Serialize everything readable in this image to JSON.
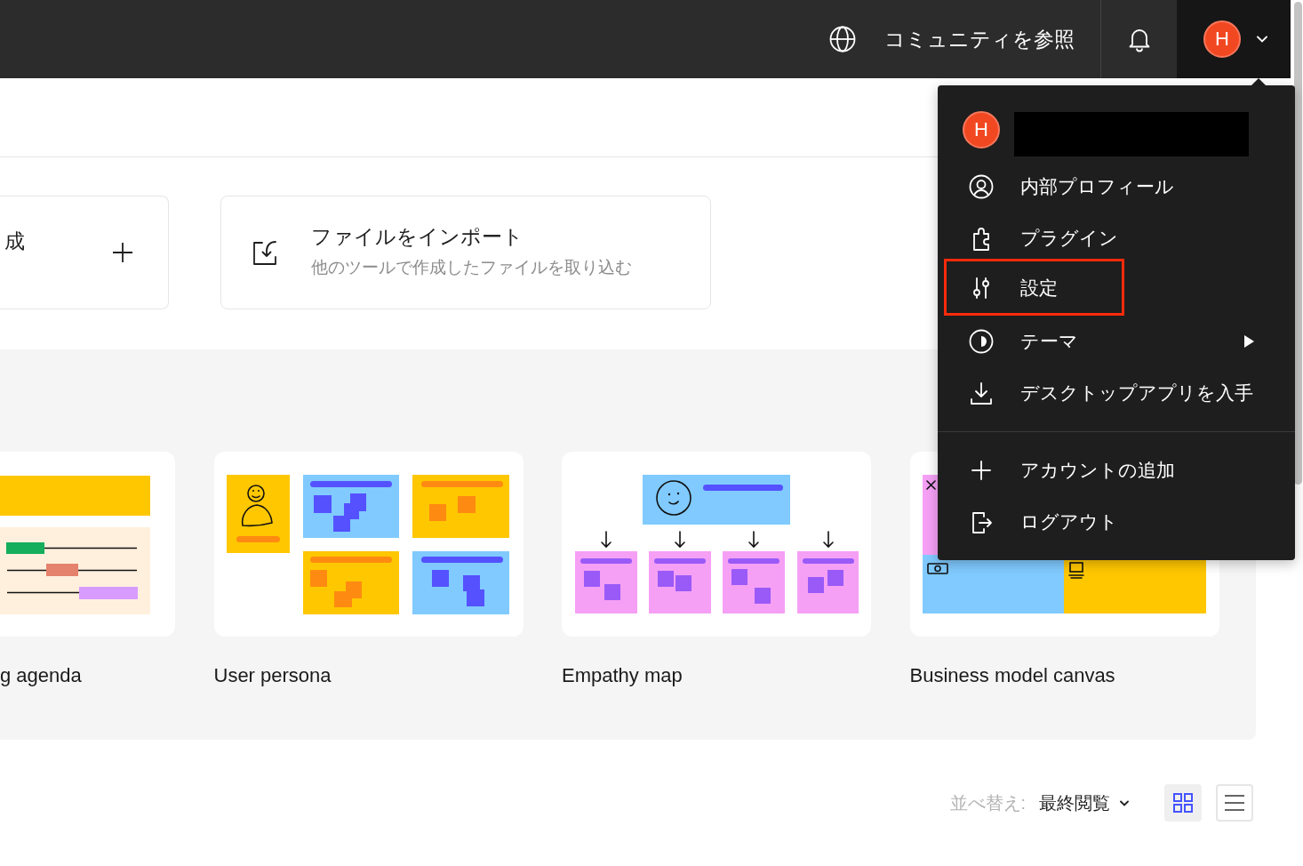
{
  "header": {
    "community_link": "コミュニティを参照",
    "avatar_initial": "H"
  },
  "actions": [
    {
      "kind": "create",
      "title": "成"
    },
    {
      "kind": "import",
      "title": "ファイルをインポート",
      "description": "他のツールで作成したファイルを取り込む"
    }
  ],
  "templates": [
    {
      "kind": "agenda",
      "label": "g agenda"
    },
    {
      "kind": "persona",
      "label": "User persona"
    },
    {
      "kind": "empathy-map",
      "label": "Empathy map"
    },
    {
      "kind": "canvas",
      "label": "Business model canvas"
    }
  ],
  "toolbar": {
    "sort_label": "並べ替え:",
    "sort_value": "最終閲覧",
    "views": [
      {
        "kind": "grid",
        "selected": true
      },
      {
        "kind": "list",
        "selected": false
      }
    ]
  },
  "account_menu": {
    "open": true,
    "avatar_initial": "H",
    "name_redacted": true,
    "groups": [
      {
        "items": [
          {
            "label": "内部プロフィール",
            "highlighted": false,
            "submenu": false
          },
          {
            "label": "プラグイン",
            "highlighted": false,
            "submenu": false
          },
          {
            "label": "設定",
            "highlighted": true,
            "submenu": false
          },
          {
            "label": "テーマ",
            "highlighted": false,
            "submenu": true
          },
          {
            "label": "デスクトップアプリを入手",
            "highlighted": false,
            "submenu": false
          }
        ]
      },
      {
        "items": [
          {
            "label": "アカウントの追加",
            "highlighted": false,
            "submenu": false
          },
          {
            "label": "ログアウト",
            "highlighted": false,
            "submenu": false
          }
        ]
      }
    ]
  }
}
